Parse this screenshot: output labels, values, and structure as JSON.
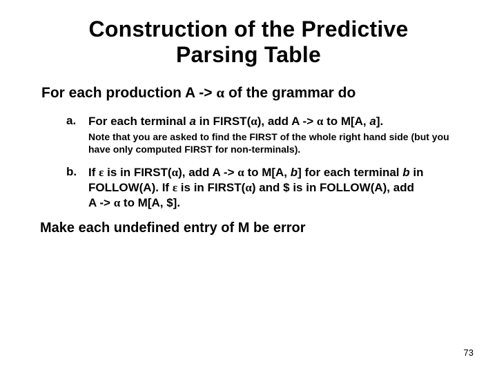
{
  "title_l1": "Construction of the Predictive",
  "title_l2": "Parsing Table",
  "intro_pre": "For each production A -> ",
  "alpha": "α",
  "eps": "ε",
  "intro_post": " of the grammar do",
  "a_marker": "a.",
  "a_p1": "For each terminal ",
  "a_ai": "a",
  "a_p2": " in FIRST(",
  "a_p3": "), add A -> ",
  "a_p4": " to M[A, ",
  "a_p5": "].",
  "a_note": "Note that  you are asked to find the FIRST of the whole right hand side (but you have only computed FIRST for non-terminals).",
  "b_marker": "b.",
  "b_p1": "If ",
  "b_p2": " is in FIRST(",
  "b_p3": "), add A -> ",
  "b_p4": " to M[A, ",
  "b_bi": "b",
  "b_p5": "] for each terminal ",
  "b_p6": " in FOLLOW(A). If ",
  "b_p7": " is in FIRST(",
  "b_p8": ") and $ is in FOLLOW(A), add",
  "b_p9": "A -> ",
  "b_p10": " to M[A, $].",
  "outro": "Make each undefined entry of M be error",
  "pagenum": "73"
}
